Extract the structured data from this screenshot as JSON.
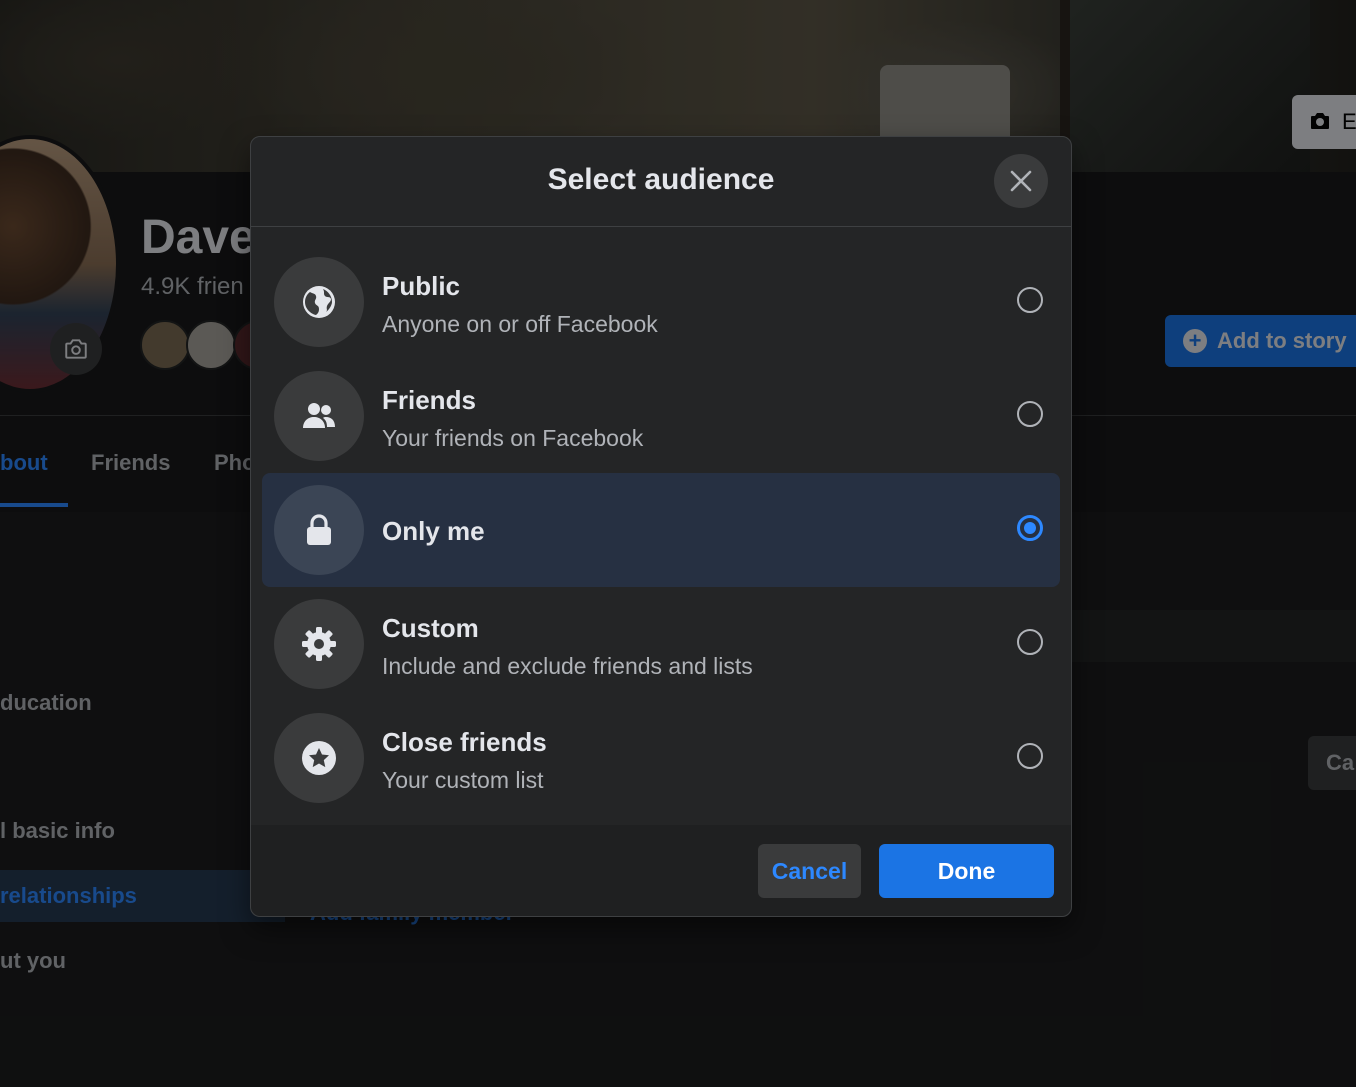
{
  "background": {
    "profile_name": "Dave",
    "friend_count": "4.9K frien",
    "edit_cover_label": "E",
    "add_story_label": "Add to story",
    "tabs": [
      "bout",
      "Friends",
      "Pho"
    ],
    "sidebar": [
      "ducation",
      "l basic info",
      "relationships",
      "ut you"
    ],
    "card_button": "Ca",
    "add_family": "Add family member"
  },
  "dialog": {
    "title": "Select audience",
    "close_icon": "close-icon",
    "options": [
      {
        "title": "Public",
        "subtitle": "Anyone on or off Facebook",
        "icon": "globe-icon",
        "selected": false
      },
      {
        "title": "Friends",
        "subtitle": "Your friends on Facebook",
        "icon": "friends-icon",
        "selected": false
      },
      {
        "title": "Only me",
        "subtitle": "",
        "icon": "lock-icon",
        "selected": true
      },
      {
        "title": "Custom",
        "subtitle": "Include and exclude friends and lists",
        "icon": "gear-icon",
        "selected": false
      },
      {
        "title": "Close friends",
        "subtitle": "Your custom list",
        "icon": "star-icon",
        "selected": false
      }
    ],
    "cancel_label": "Cancel",
    "done_label": "Done"
  },
  "colors": {
    "accent": "#2d88ff",
    "primary_button": "#1b74e4",
    "dialog_bg": "#242526",
    "selected_row": "#263042"
  }
}
